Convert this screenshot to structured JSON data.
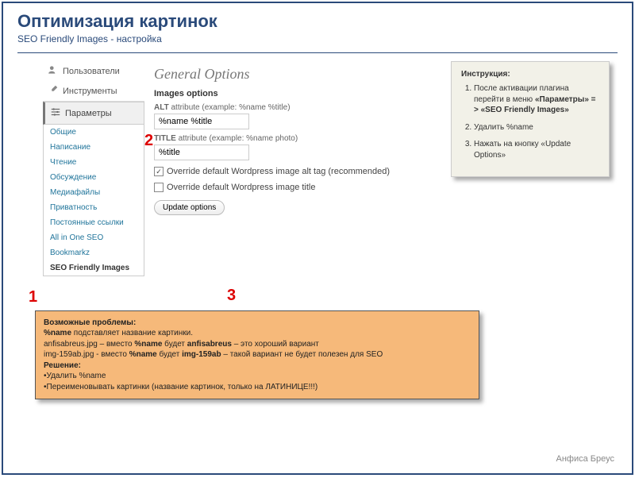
{
  "header": {
    "title": "Оптимизация картинок",
    "subtitle": "SEO Friendly Images - настройка"
  },
  "wp": {
    "topItems": [
      {
        "name": "users",
        "label": "Пользователи"
      },
      {
        "name": "tools",
        "label": "Инструменты"
      }
    ],
    "section": "Параметры",
    "subItems": [
      "Общие",
      "Написание",
      "Чтение",
      "Обсуждение",
      "Медиафайлы",
      "Приватность",
      "Постоянные ссылки",
      "All in One SEO",
      "Bookmarkz",
      "SEO Friendly Images"
    ],
    "activeIndex": 9,
    "main": {
      "genTitle": "General Options",
      "sect": "Images options",
      "altLabel": "ALT",
      "altHint": "attribute (example: %name %title)",
      "altValue": "%name %title",
      "titleLabel": "TITLE",
      "titleHint": "attribute (example: %name photo)",
      "titleValue": "%title",
      "chk1": "Override default Wordpress image alt tag (recommended)",
      "chk2": "Override default Wordpress image title",
      "btn": "Update options"
    }
  },
  "steps": {
    "s1": "1",
    "s2": "2",
    "s3": "3"
  },
  "inst": {
    "title": "Инструкция:",
    "i1a": "После активации плагина перейти в меню ",
    "i1b": "«Параметры» = > «SEO Friendly Images»",
    "i2": "Удалить %name",
    "i3": "Нажать на кнопку «Update Options»"
  },
  "prob": {
    "title": "Возможные проблемы:",
    "l1a": "%name",
    "l1b": " подставляет название картинки.",
    "l2a": "anfisabreus.jpg – вместо ",
    "l2b": "%name",
    "l2c": " будет ",
    "l2d": "anfisabreus",
    "l2e": " – это хороший вариант",
    "l3a": "img-159ab.jpg - вместо ",
    "l3b": "%name",
    "l3c": " будет  ",
    "l3d": "img-159ab",
    "l3e": " – такой вариант не будет полезен для SEO",
    "sol": "Решение:",
    "b1": "Удалить %name",
    "b2": "Переименовывать картинки (название картинок, только на ЛАТИНИЦЕ!!!)"
  },
  "footer": "Анфиса Бреус"
}
